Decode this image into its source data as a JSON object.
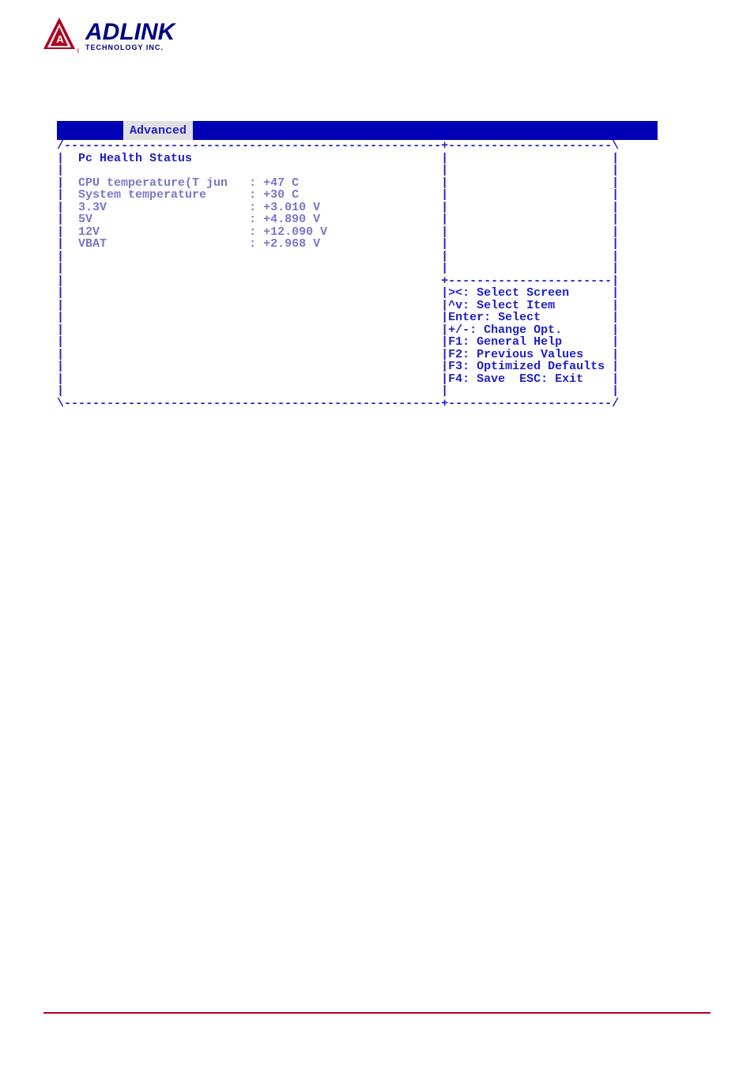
{
  "logo": {
    "main": "ADLINK",
    "sub": "TECHNOLOGY INC."
  },
  "tab": {
    "active": "Advanced"
  },
  "section_title": "Pc Health Status",
  "readings": [
    {
      "label": "CPU temperature(T jun",
      "value": ": +47 C"
    },
    {
      "label": "System temperature",
      "value": ": +30 C"
    },
    {
      "label": "3.3V",
      "value": ": +3.010 V"
    },
    {
      "label": "5V",
      "value": ": +4.890 V"
    },
    {
      "label": "12V",
      "value": ": +12.090 V"
    },
    {
      "label": "VBAT",
      "value": ": +2.968 V"
    }
  ],
  "help": [
    "><: Select Screen",
    "^v: Select Item",
    "Enter: Select",
    "+/-: Change Opt.",
    "F1: General Help",
    "F2: Previous Values",
    "F3: Optimized Defaults",
    "F4: Save  ESC: Exit"
  ]
}
